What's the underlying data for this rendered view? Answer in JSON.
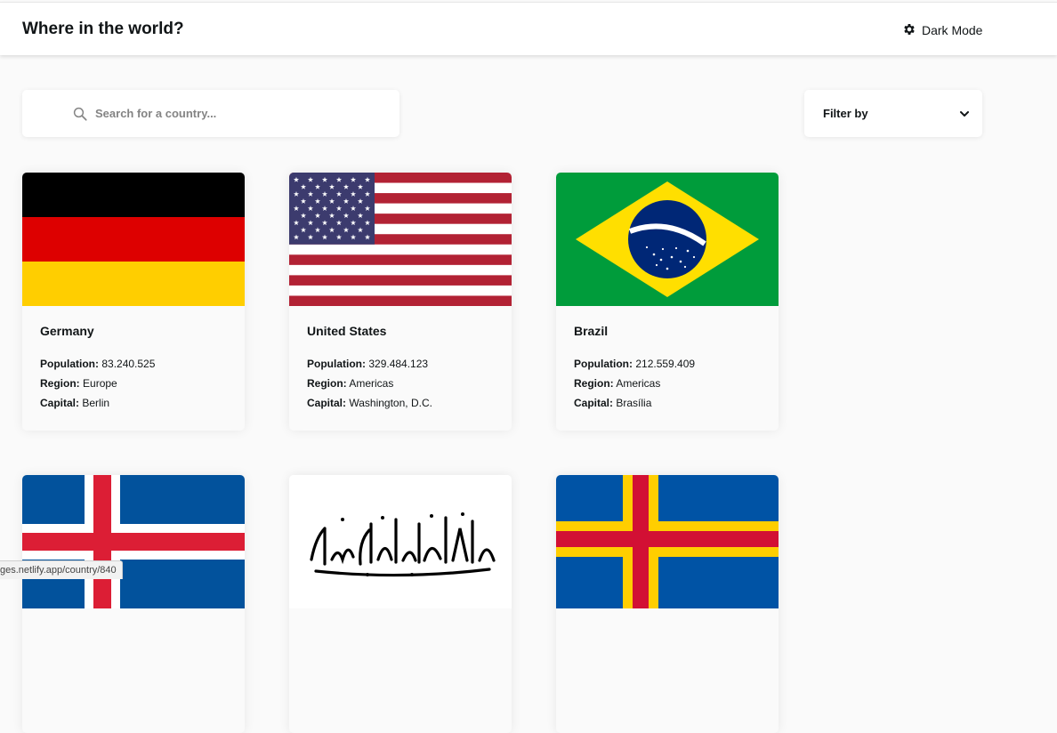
{
  "header": {
    "title": "Where in the world?",
    "mode_label": "Dark Mode",
    "mode_icon": "gear-icon"
  },
  "search": {
    "placeholder": "Search for a country...",
    "value": "",
    "icon": "search-icon"
  },
  "filter": {
    "label": "Filter by",
    "icon": "chevron-down-icon"
  },
  "labels": {
    "population": "Population:",
    "region": "Region:",
    "capital": "Capital:"
  },
  "countries": [
    {
      "name": "Germany",
      "population": "83.240.525",
      "region": "Europe",
      "capital": "Berlin",
      "flag": "germany-flag"
    },
    {
      "name": "United States",
      "population": "329.484.123",
      "region": "Americas",
      "capital": "Washington, D.C.",
      "flag": "usa-flag"
    },
    {
      "name": "Brazil",
      "population": "212.559.409",
      "region": "Americas",
      "capital": "Brasília",
      "flag": "brazil-flag"
    },
    {
      "flag": "iceland-flag"
    },
    {
      "flag": "afghanistan-flag"
    },
    {
      "flag": "aland-flag"
    }
  ],
  "status_bar": {
    "text": "ges.netlify.app/country/840"
  },
  "colors": {
    "background": "#fafafa",
    "card": "#ffffff",
    "text": "#111517",
    "placeholder": "#848484"
  }
}
